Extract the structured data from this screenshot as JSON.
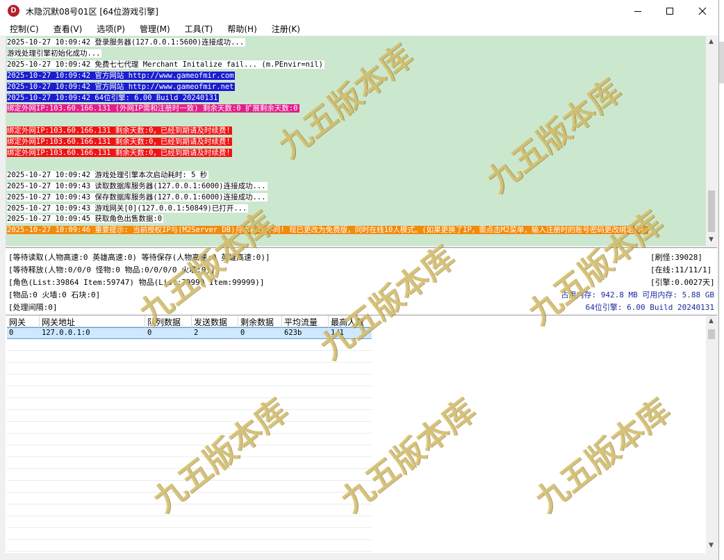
{
  "window": {
    "title": "木隐沉默08号01区 [64位游戏引擎]",
    "icon_letter": "D"
  },
  "menu": [
    {
      "label": "控制(C)"
    },
    {
      "label": "查看(V)"
    },
    {
      "label": "选项(P)"
    },
    {
      "label": "管理(M)"
    },
    {
      "label": "工具(T)"
    },
    {
      "label": "帮助(H)"
    },
    {
      "label": "注册(K)"
    }
  ],
  "log": [
    {
      "text": "2025-10-27 10:09:42 登录服务器(127.0.0.1:5600)连接成功...",
      "style": "plain"
    },
    {
      "text": "游戏处理引擎初始化成功...",
      "style": "plain"
    },
    {
      "text": "2025-10-27 10:09:42 免费七七代理 Merchant Initalize fail... (m.PEnvir=nil)",
      "style": "plain"
    },
    {
      "text": "2025-10-27 10:09:42 官方网站 http://www.gameofmir.com",
      "style": "blue"
    },
    {
      "text": "2025-10-27 10:09:42 官方网站 http://www.gameofmir.net",
      "style": "blue"
    },
    {
      "text": "2025-10-27 10:09:42 64位引擎: 6.00 Build 20240131",
      "style": "blue"
    },
    {
      "text": "绑定外网IP:103.60.166.131 (外网IP需和注册时一致) 剩余天数:0 扩展剩余天数:0",
      "style": "magenta"
    },
    {
      "text": "",
      "style": "blank"
    },
    {
      "text": "绑定外网IP:103.60.166.131 剩余天数:0，已经到期请及时续费!",
      "style": "red"
    },
    {
      "text": "绑定外网IP:103.60.166.131 剩余天数:0，已经到期请及时续费!",
      "style": "red"
    },
    {
      "text": "绑定外网IP:103.60.166.131 剩余天数:0，已经到期请及时续费!",
      "style": "red"
    },
    {
      "text": "",
      "style": "blank"
    },
    {
      "text": "2025-10-27 10:09:42 游戏处理引擎本次启动耗时: 5 秒",
      "style": "plain"
    },
    {
      "text": "2025-10-27 10:09:43 读取数据库服务器(127.0.0.1:6000)连接成功...",
      "style": "plain"
    },
    {
      "text": "2025-10-27 10:09:43 保存数据库服务器(127.0.0.1:6000)连接成功...",
      "style": "plain"
    },
    {
      "text": "2025-10-27 10:09:43 游戏网关[0](127.0.0.1:50849)已打开...",
      "style": "plain"
    },
    {
      "text": "2025-10-27 10:09:45 获取角色出售数据:0",
      "style": "plain"
    },
    {
      "text": "2025-10-27 10:09:46 重要提示: 当前授权IP与(M2Server DB)与本机IP不同! 现已更改为免费版，同时在线10人模式。(如果更换了IP，需点击M2菜单，输入注册时的账号密码更改绑定IP)",
      "style": "orange"
    }
  ],
  "status": {
    "left": [
      "[等待读取(人物高速:0 英雄高速:0) 等待保存(人物高速:0 英雄高速:0)]",
      "[等待释放(人物:0/0/0 怪物:0 物品:0/0/0/0 火墙:0)]",
      "[角色(List:39864 Item:59747) 物品(List:79999 Item:99999)]",
      "[物品:0 火墙:0 石块:0]",
      "[处理间隔:0]"
    ],
    "right": [
      "[刷怪:39028]",
      "[在线:11/11/1]",
      "[引擎:0.0027天]",
      "占用内存: 942.8 MB 可用内存: 5.88 GB",
      "64位引擎: 6.00 Build 20240131"
    ]
  },
  "grid": {
    "columns": [
      "网关",
      "网关地址",
      "队列数据",
      "发送数据",
      "剩余数据",
      "平均流量",
      "最高人数"
    ],
    "rows": [
      [
        "0",
        "127.0.0.1:0",
        "0",
        "2",
        "0",
        "623b",
        "1/1"
      ]
    ]
  },
  "watermark": {
    "text": "九五版本库",
    "color": "#e2cd78"
  }
}
